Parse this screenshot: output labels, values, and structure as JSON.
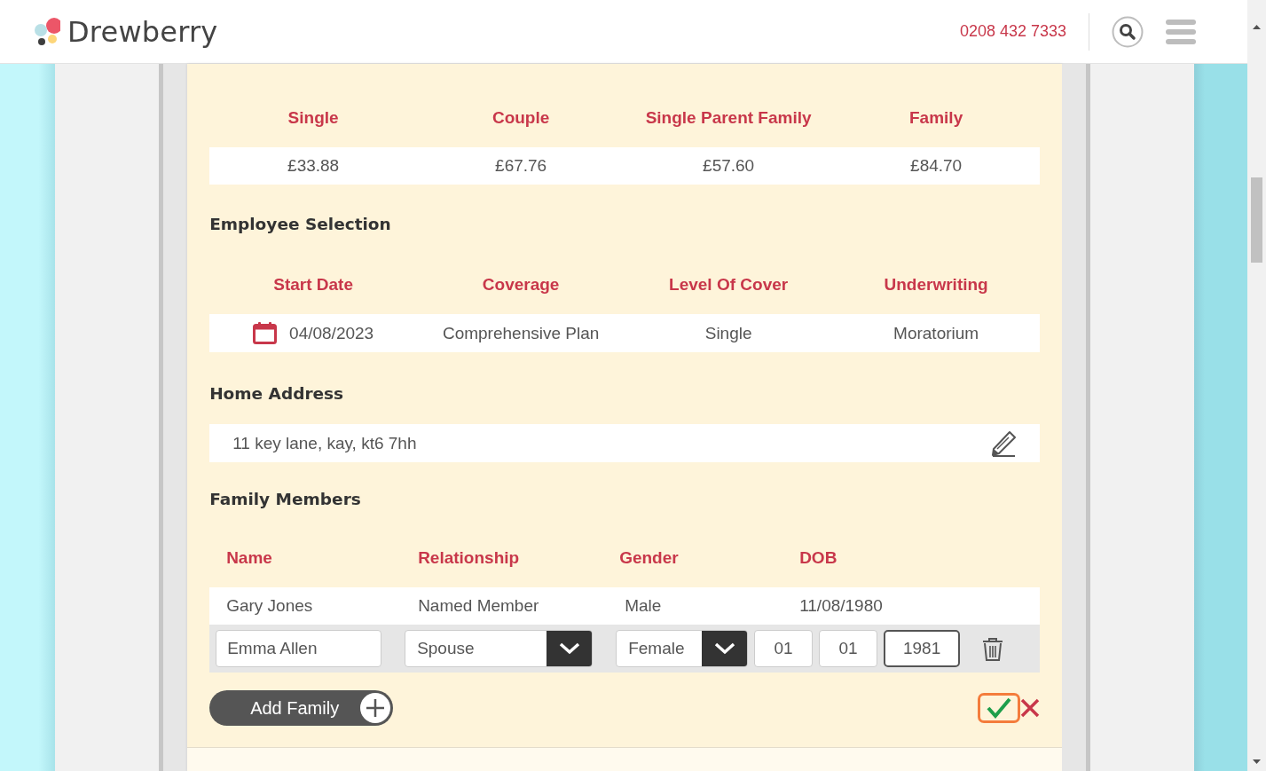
{
  "header": {
    "logo_text": "Drewberry",
    "phone": "0208 432 7333"
  },
  "prices": {
    "columns": [
      "Single",
      "Couple",
      "Single Parent Family",
      "Family"
    ],
    "values": [
      "£33.88",
      "£67.76",
      "£57.60",
      "£84.70"
    ]
  },
  "employee_selection": {
    "title": "Employee Selection",
    "columns": [
      "Start Date",
      "Coverage",
      "Level Of Cover",
      "Underwriting"
    ],
    "row": {
      "start_date": "04/08/2023",
      "coverage": "Comprehensive Plan",
      "level_of_cover": "Single",
      "underwriting": "Moratorium"
    }
  },
  "home_address": {
    "title": "Home Address",
    "address": "11 key lane, kay, kt6 7hh"
  },
  "family_members": {
    "title": "Family Members",
    "columns": [
      "Name",
      "Relationship",
      "Gender",
      "DOB"
    ],
    "rows": [
      {
        "name": "Gary Jones",
        "relationship": "Named Member",
        "gender": "Male",
        "dob": "11/08/1980"
      }
    ],
    "edit_row": {
      "name": "Emma Allen",
      "relationship": "Spouse",
      "gender": "Female",
      "dob_day": "01",
      "dob_month": "01",
      "dob_year": "1981"
    },
    "add_button": "Add Family"
  }
}
